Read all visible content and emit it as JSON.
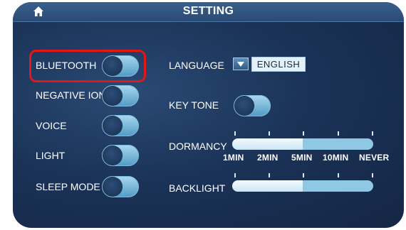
{
  "header": {
    "title": "SETTING",
    "home_icon": "home-icon"
  },
  "left_settings": [
    {
      "label": "BLUETOOTH",
      "state": "off",
      "selected": true
    },
    {
      "label": "NEGATIVE ION",
      "state": "off"
    },
    {
      "label": "VOICE",
      "state": "off"
    },
    {
      "label": "LIGHT",
      "state": "off"
    },
    {
      "label": "SLEEP MODE",
      "state": "off"
    }
  ],
  "language": {
    "label": "LANGUAGE",
    "value": "ENGLISH"
  },
  "key_tone": {
    "label": "KEY TONE",
    "state": "off"
  },
  "dormancy": {
    "label": "DORMANCY",
    "options": [
      "1MIN",
      "2MIN",
      "5MIN",
      "10MIN",
      "NEVER"
    ],
    "selected": "5MIN",
    "level": 0.5
  },
  "backlight": {
    "label": "BACKLIGHT",
    "level": 0.5
  },
  "colors": {
    "highlight": "#e01818",
    "panel": "#1b3358",
    "toggle": "#6fb3d8"
  }
}
